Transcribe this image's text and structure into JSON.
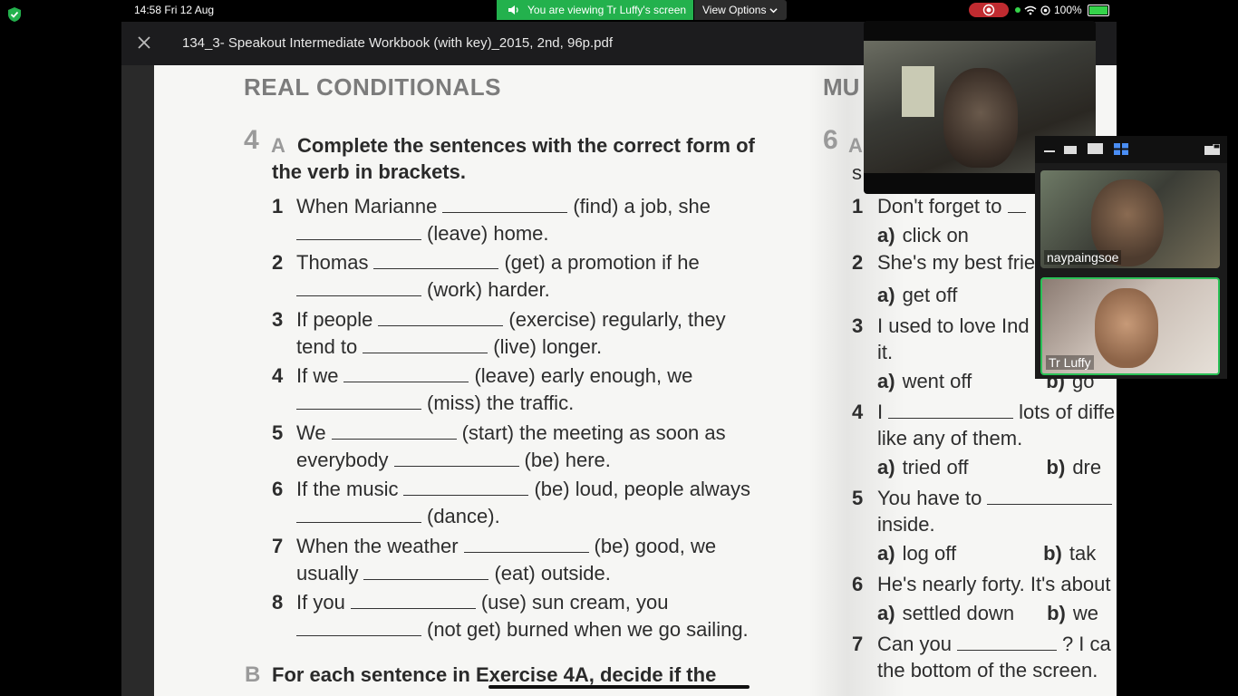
{
  "status_bar": {
    "time": "14:58  Fri 12 Aug",
    "share_text": "You are viewing Tr Luffy's screen",
    "view_options": "View Options",
    "battery": "100%"
  },
  "document": {
    "title": "134_3- Speakout Intermediate Workbook (with key)_2015, 2nd, 96p.pdf"
  },
  "page": {
    "section_title": "REAL CONDITIONALS",
    "section_title_right": "MU",
    "exercise_number": "4",
    "exercise_letter": "A",
    "exercise_instruction": "Complete the sentences with the correct form of the verb in brackets.",
    "items": [
      {
        "n": "1",
        "l1a": "When Marianne",
        "l1b": "(find) a job, she",
        "l2b": "(leave) home."
      },
      {
        "n": "2",
        "l1a": "Thomas",
        "l1b": "(get) a promotion if he",
        "l2b": "(work) harder."
      },
      {
        "n": "3",
        "l1a": "If people",
        "l1b": "(exercise) regularly, they",
        "l2a": "tend to",
        "l2b": "(live) longer."
      },
      {
        "n": "4",
        "l1a": "If we",
        "l1b": "(leave) early enough, we",
        "l2b": "(miss) the traffic."
      },
      {
        "n": "5",
        "l1a": "We",
        "l1b": "(start) the meeting as soon as",
        "l2a": "everybody",
        "l2b": "(be) here."
      },
      {
        "n": "6",
        "l1a": "If the music",
        "l1b": "(be) loud, people always",
        "l2b": "(dance)."
      },
      {
        "n": "7",
        "l1a": "When the weather",
        "l1b": "(be) good, we",
        "l2a": "usually",
        "l2b": "(eat) outside."
      },
      {
        "n": "8",
        "l1a": "If you",
        "l1b": "(use) sun cream, you",
        "l2b": "(not get) burned when we go sailing."
      }
    ],
    "exercise_b_letter": "B",
    "exercise_b_text": "For each sentence in Exercise 4A, decide if the",
    "right_column": {
      "exercise_number": "6",
      "exercise_letter": "A",
      "s_char": "s",
      "items": [
        {
          "n": "1",
          "text": "Don't forget to"
        },
        {
          "n": "2",
          "text": "She's my best frie"
        },
        {
          "n": "3",
          "text": "I used to love Ind"
        },
        {
          "n": "4",
          "text": "I",
          "text_after": "lots of diffe"
        },
        {
          "n": "5",
          "text": "You have to"
        },
        {
          "n": "6",
          "text": "He's nearly forty. It's about"
        },
        {
          "n": "7",
          "text": "Can you",
          "text_after": "? I ca"
        }
      ],
      "continuations": [
        "it.",
        "like any of them.",
        "inside.",
        "the bottom of the screen."
      ],
      "options": [
        {
          "a": "a)",
          "a_text": "click on"
        },
        {
          "a": "a)",
          "a_text": "get off"
        },
        {
          "a": "a)",
          "a_text": "went off",
          "b": "b)",
          "b_text": "go"
        },
        {
          "a": "a)",
          "a_text": "tried off",
          "b": "b)",
          "b_text": "dre"
        },
        {
          "a": "a)",
          "a_text": "log off",
          "b": "b)",
          "b_text": "tak"
        },
        {
          "a": "a)",
          "a_text": "settled down",
          "b": "b)",
          "b_text": "we"
        }
      ]
    }
  },
  "participants": [
    {
      "name": "naypaingsoe"
    },
    {
      "name": "Tr Luffy",
      "active_speaker": true
    }
  ],
  "colors": {
    "share_green": "#23b14d",
    "record_red": "#c02b30",
    "active_border": "#2bc157"
  }
}
